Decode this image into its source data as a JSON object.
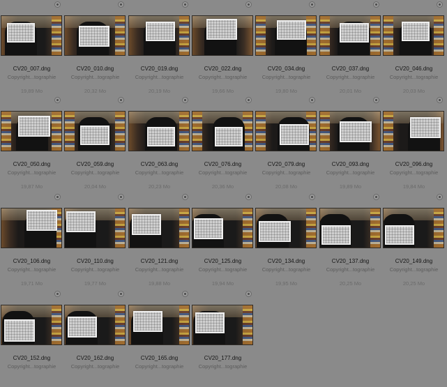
{
  "browser": {
    "items": [
      {
        "filename": "CV20_007.dng",
        "copyright": "Copyright...tographie",
        "size": "19,89 Mo"
      },
      {
        "filename": "CV20_010.dng",
        "copyright": "Copyright...tographie",
        "size": "20,32 Mo"
      },
      {
        "filename": "CV20_019.dng",
        "copyright": "Copyright...tographie",
        "size": "20,19 Mo"
      },
      {
        "filename": "CV20_022.dng",
        "copyright": "Copyright...tographie",
        "size": "19,66 Mo"
      },
      {
        "filename": "CV20_034.dng",
        "copyright": "Copyright...tographie",
        "size": "19,80 Mo"
      },
      {
        "filename": "CV20_037.dng",
        "copyright": "Copyright...tographie",
        "size": "20,01 Mo"
      },
      {
        "filename": "CV20_046.dng",
        "copyright": "Copyright...tographie",
        "size": "20,03 Mo"
      },
      {
        "filename": "CV20_050.dng",
        "copyright": "Copyright...tographie",
        "size": "19,87 Mo"
      },
      {
        "filename": "CV20_059.dng",
        "copyright": "Copyright...tographie",
        "size": "20,04 Mo"
      },
      {
        "filename": "CV20_063.dng",
        "copyright": "Copyright...tographie",
        "size": "20,23 Mo"
      },
      {
        "filename": "CV20_076.dng",
        "copyright": "Copyright...tographie",
        "size": "20,36 Mo"
      },
      {
        "filename": "CV20_079.dng",
        "copyright": "Copyright...tographie",
        "size": "20,08 Mo"
      },
      {
        "filename": "CV20_093.dng",
        "copyright": "Copyright...tographie",
        "size": "19,89 Mo"
      },
      {
        "filename": "CV20_096.dng",
        "copyright": "Copyright...tographie",
        "size": "19,84 Mo"
      },
      {
        "filename": "CV20_106.dng",
        "copyright": "Copyright...tographie",
        "size": "19,71 Mo"
      },
      {
        "filename": "CV20_110.dng",
        "copyright": "Copyright...tographie",
        "size": "19,77 Mo"
      },
      {
        "filename": "CV20_121.dng",
        "copyright": "Copyright...tographie",
        "size": "19,88 Mo"
      },
      {
        "filename": "CV20_125.dng",
        "copyright": "Copyright...tographie",
        "size": "19,94 Mo"
      },
      {
        "filename": "CV20_134.dng",
        "copyright": "Copyright...tographie",
        "size": "19,95 Mo"
      },
      {
        "filename": "CV20_137.dng",
        "copyright": "Copyright...tographie",
        "size": "20,25 Mo"
      },
      {
        "filename": "CV20_149.dng",
        "copyright": "Copyright...tographie",
        "size": "20,25 Mo"
      },
      {
        "filename": "CV20_152.dng",
        "copyright": "Copyright...tographie",
        "size": ""
      },
      {
        "filename": "CV20_162.dng",
        "copyright": "Copyright...tographie",
        "size": ""
      },
      {
        "filename": "CV20_165.dng",
        "copyright": "Copyright...tographie",
        "size": ""
      },
      {
        "filename": "CV20_177.dng",
        "copyright": "Copyright...tographie",
        "size": ""
      }
    ],
    "badge_icon": "option-badge-icon",
    "colors": {
      "background": "#8a8a8a",
      "filename": "#161616",
      "meta": "#5c5c5c"
    }
  }
}
